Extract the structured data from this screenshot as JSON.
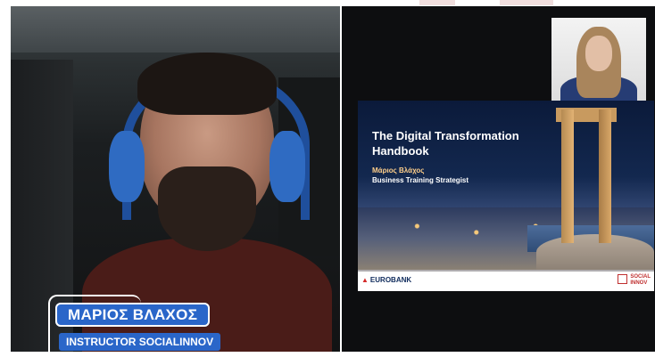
{
  "speaker": {
    "name": "ΜΑΡΙΟΣ ΒΛΑΧΟΣ",
    "role": "INSTRUCTOR SOCIALINNOV"
  },
  "slide": {
    "title": "The Digital Transformation Handbook",
    "author": "Μάριος Βλάχος",
    "job_title": "Business Training Strategist",
    "logo_left": "EUROBANK",
    "logo_right_line1": "SOCIAL",
    "logo_right_line2": "INNOV"
  },
  "colors": {
    "name_tag": "#2a66c9",
    "background": "#0d0e10"
  }
}
